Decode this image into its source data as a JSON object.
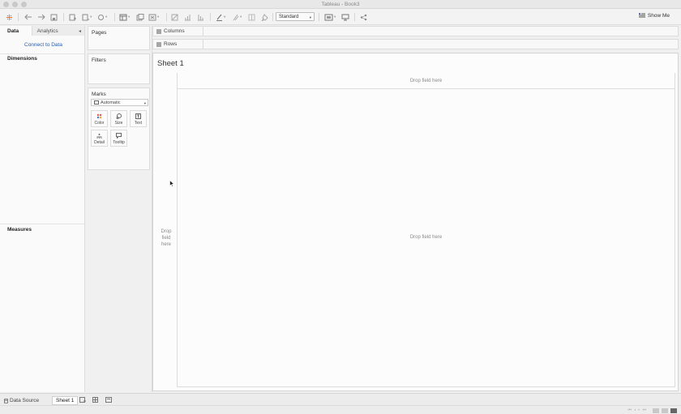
{
  "window": {
    "title": "Tableau - Book3"
  },
  "toolbar": {
    "icons": [
      "tableau-logo-icon",
      "back-icon",
      "forward-icon",
      "save-icon",
      "new-data-source-icon",
      "pause-updates-icon",
      "refresh-icon",
      "new-worksheet-icon",
      "duplicate-sheet-icon",
      "clear-sheet-icon",
      "swap-icon",
      "sort-ascending-icon",
      "sort-descending-icon",
      "highlight-icon",
      "group-icon",
      "show-labels-icon",
      "fix-axes-icon",
      "fit-icon",
      "presentation-icon",
      "share-icon"
    ],
    "view_mode": "Standard",
    "show_me_label": "Show Me"
  },
  "left_panel": {
    "tabs": {
      "data": "Data",
      "analytics": "Analytics"
    },
    "connect_link": "Connect to Data",
    "dimensions_label": "Dimensions",
    "measures_label": "Measures"
  },
  "cards": {
    "pages": "Pages",
    "filters": "Filters",
    "marks": {
      "title": "Marks",
      "type": "Automatic",
      "buttons": {
        "color": "Color",
        "size": "Size",
        "text": "Text",
        "detail": "Detail",
        "tooltip": "Tooltip"
      }
    }
  },
  "shelves": {
    "columns": "Columns",
    "rows": "Rows"
  },
  "sheet": {
    "title": "Sheet 1",
    "drop_top": "Drop field here",
    "drop_left": "Drop field here",
    "drop_main": "Drop field here"
  },
  "bottom_tabs": {
    "data_source": "Data Source",
    "sheet1": "Sheet 1"
  },
  "colors": {
    "accent_link": "#2a5aa8",
    "canvas": "#fcfcfc",
    "chrome": "#f0f0f0"
  }
}
